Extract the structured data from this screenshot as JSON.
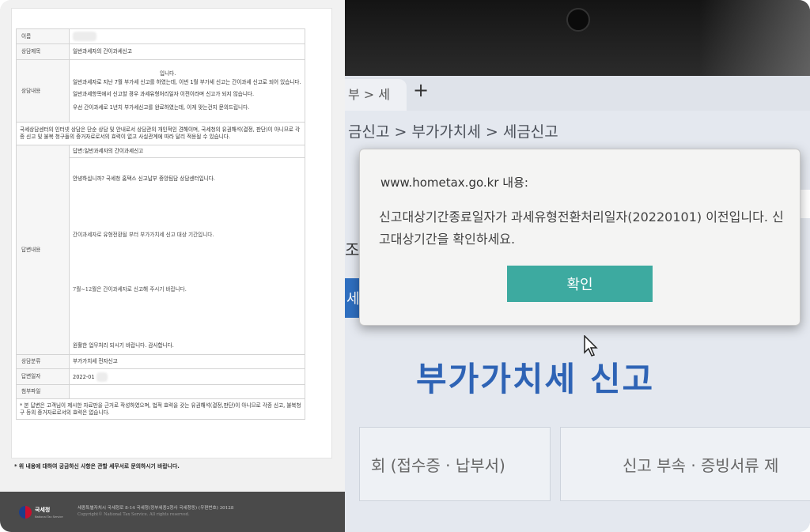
{
  "document": {
    "rows": [
      {
        "label": "이름",
        "value": ""
      },
      {
        "label": "상담제목",
        "value": "일반과세자의 간이과세신고"
      },
      {
        "label": "상담내용",
        "lines": [
          "입니다.",
          "일반과세자로 지난 7월 부가세 신고를 하였는데, 이번 1월 부가세 신고는 간이과세 신고로 되어 있습니다.",
          "일반과세항목에서 신고할 경우 과세유형처리일자 이전이라며 신고가 되지 않습니다.",
          "우선 간이과세로 1년치 부가세신고를 완료하였는데, 이게 맞는건지 문의드립니다."
        ]
      },
      {
        "label": "답변내용",
        "lines": [
          "답변:일반과세자의 간이과세신고",
          "안녕하십니까? 국세청 홈택스 신고납부 중앙팀담 상담센터입니다.",
          "간이과세자로 유형전환될 부터 부가가치세 신고 대상 기간입니다.",
          "7월~12월은 간이과세자로 신고해 주시기 바랍니다.",
          "원활한 업무처리 되시기 바랍니다. 감사합니다."
        ]
      },
      {
        "label": "상담분류",
        "value": "부가가치세 전자신고"
      },
      {
        "label": "답변일자",
        "value": "2022-01"
      },
      {
        "label": "첨부파일",
        "value": ""
      }
    ],
    "notice_row": "국세상담센터의 인터넷 상담은 단순 상담 및 안내로서 상담관의 개인적인 견해이며, 국세청의 유권해석(결정, 판단)이 아니므로 각종 신고 및 불복 청구들의 증거자료로서의 효력이 없고 사실관계에 따라 달리 적용될 수 있습니다.",
    "disclaimer": "* 본 답변은 고객님이 제시한 자료만을 근거로 작성하였으며, 법적 효력을 갖는 유권해석(결정,판단)이 아니므로 각종 신고, 불복청구 등의 증거자료로서의 효력은 없습니다.",
    "bottom_note": "* 위 내용에 대하여 궁금하신 사항은 관할 세무서로 문의하시기 바랍니다.",
    "footer": {
      "logo_text": "국세청",
      "logo_sub": "National Tax Service",
      "address": "세종특별자치시 국세청로 8-14 국세청(정부세종2청사 국세청동) (우편번호) 30128",
      "copyright": "Copyright© National Tax Service. All rights reserved."
    }
  },
  "browser": {
    "tab_label": "부 > 세",
    "new_tab": "+",
    "breadcrumb": "금신고 > 부가가치세 > 세금신고",
    "partial_left": "조",
    "partial_blue": "세"
  },
  "dialog": {
    "title": "www.hometax.go.kr 내용:",
    "message": "신고대상기간종료일자가 과세유형전환처리일자(20220101) 이전입니다. 신고대상기간을 확인하세요.",
    "ok_label": "확인"
  },
  "page": {
    "heading": "부가가치세 신고",
    "card_left": "회 (접수증 · 납부서)",
    "card_right": "신고 부속 · 증빙서류 제"
  },
  "colors": {
    "ok_button": "#3daaa0",
    "heading": "#2e63b5",
    "footer": "#4a4a4a"
  }
}
